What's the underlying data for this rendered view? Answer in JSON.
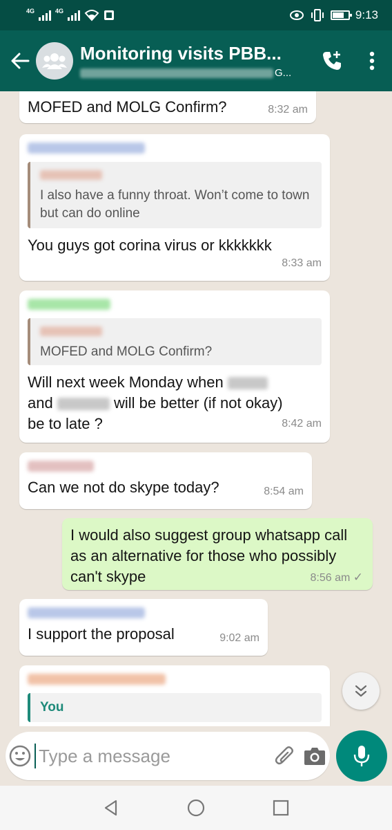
{
  "status_bar": {
    "network_1": "4G",
    "network_2": "4G",
    "time": "9:13",
    "icons": [
      "signal-icon",
      "wifi-icon",
      "notification-icon",
      "eye-icon",
      "vibrate-icon",
      "battery-icon"
    ]
  },
  "header": {
    "title": "Monitoring visits PBB...",
    "subtitle_end": "G...",
    "icons": [
      "back-arrow-icon",
      "group-avatar-icon",
      "add-call-icon",
      "more-vertical-icon"
    ]
  },
  "messages": [
    {
      "direction": "in",
      "text": "MOFED and MOLG Confirm?",
      "time": "8:32 am"
    },
    {
      "direction": "in",
      "quote": "I also have a funny throat. Won’t come to town but can do online",
      "text": "You guys got corina virus or kkkkkkk",
      "time": "8:33 am"
    },
    {
      "direction": "in",
      "quote": "MOFED and MOLG Confirm?",
      "text_line1": "Will next week Monday when",
      "text_line2_start": "and",
      "text_line2_end": "will be better (if not okay)",
      "text_line3": "be to late ?",
      "time": "8:42 am"
    },
    {
      "direction": "in",
      "text": "Can we not do skype today?",
      "time": "8:54 am"
    },
    {
      "direction": "out",
      "text": "I would also suggest group whatsapp call as an alternative for those who possibly can't skype",
      "time": "8:56 am",
      "status": "✓"
    },
    {
      "direction": "in",
      "text": "I support the proposal",
      "time": "9:02 am"
    },
    {
      "direction": "in",
      "quote_author": "You",
      "partial": true
    }
  ],
  "composer": {
    "placeholder": "Type a message",
    "icons": [
      "emoji-icon",
      "attach-icon",
      "camera-icon",
      "mic-icon"
    ]
  },
  "colors": {
    "header": "#075e54",
    "status_bar": "#054d44",
    "chat_bg": "#ece5dd",
    "outgoing_bubble": "#dcf8c6",
    "accent": "#00897b"
  },
  "nav_icons": [
    "back-triangle-icon",
    "home-circle-icon",
    "recents-square-icon"
  ]
}
